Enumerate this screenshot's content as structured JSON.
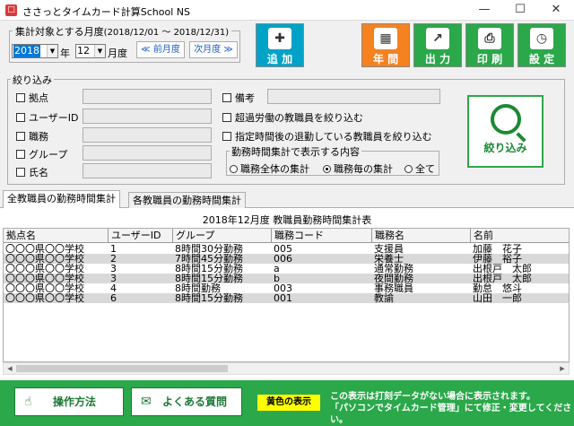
{
  "window": {
    "title": "ささっとタイムカード計算School NS",
    "controls": [
      "—",
      "☐",
      "✕"
    ]
  },
  "period": {
    "label": "集計対象とする月度",
    "range": "(2018/12/01 ～ 2018/12/31)",
    "year": "2018",
    "year_unit": "年",
    "month": "12",
    "month_unit": "月度",
    "prev_label": "≪ 前月度",
    "next_label": "次月度 ≫"
  },
  "toolbar": {
    "add_label": "追 加",
    "year_label": "年 間",
    "output_label": "出 力",
    "print_label": "印 刷",
    "settings_label": "設 定",
    "colors": {
      "add": "#00a2c7",
      "year": "#f5821f",
      "output": "#2aa84a",
      "print": "#2aa84a",
      "settings": "#2aa84a"
    }
  },
  "filter": {
    "legend": "絞り込み",
    "fields": [
      {
        "label": "拠点"
      },
      {
        "label": "ユーザーID"
      },
      {
        "label": "職務"
      },
      {
        "label": "グループ"
      },
      {
        "label": "氏名"
      }
    ],
    "remarks_label": "備考",
    "overtime_label": "超過労働の教職員を絞り込む",
    "late_leave_label": "指定時間後の退勤している教職員を絞り込む",
    "mode": {
      "legend": "勤務時間集計で表示する内容",
      "options": [
        "職務全体の集計",
        "職務毎の集計",
        "全て"
      ],
      "selected": 1
    },
    "search_label": "絞り込み"
  },
  "tabs": [
    {
      "label": "全教職員の勤務時間集計",
      "active": true
    },
    {
      "label": "各教職員の勤務時間集計",
      "active": false
    }
  ],
  "grid": {
    "title": "2018年12月度 教職員勤務時間集計表",
    "columns": [
      "拠点名",
      "ユーザーID",
      "グループ",
      "職務コード",
      "職務名",
      "名前"
    ],
    "rows": [
      [
        "〇〇〇県〇〇学校",
        "1",
        "8時間30分勤務",
        "005",
        "支援員",
        "加藤　花子"
      ],
      [
        "〇〇〇県〇〇学校",
        "2",
        "7時間45分勤務",
        "006",
        "栄養士",
        "伊藤　裕子"
      ],
      [
        "〇〇〇県〇〇学校",
        "3",
        "8時間15分勤務",
        "a",
        "通常勤務",
        "出根戸　太郎"
      ],
      [
        "〇〇〇県〇〇学校",
        "3",
        "8時間15分勤務",
        "b",
        "夜間勤務",
        "出根戸　太郎"
      ],
      [
        "〇〇〇県〇〇学校",
        "4",
        "8時間勤務",
        "003",
        "事務職員",
        "勤怠　悠斗"
      ],
      [
        "〇〇〇県〇〇学校",
        "6",
        "8時間15分勤務",
        "001",
        "教諭",
        "山田　一郎"
      ]
    ]
  },
  "footer": {
    "manual_label": "操作方法",
    "faq_label": "よくある質問",
    "yellow_label": "黄色の表示",
    "note_line1": "この表示は打刻データがない場合に表示されます。",
    "note_line2": "「パソコンでタイムカード管理」にて修正・変更してください。"
  }
}
